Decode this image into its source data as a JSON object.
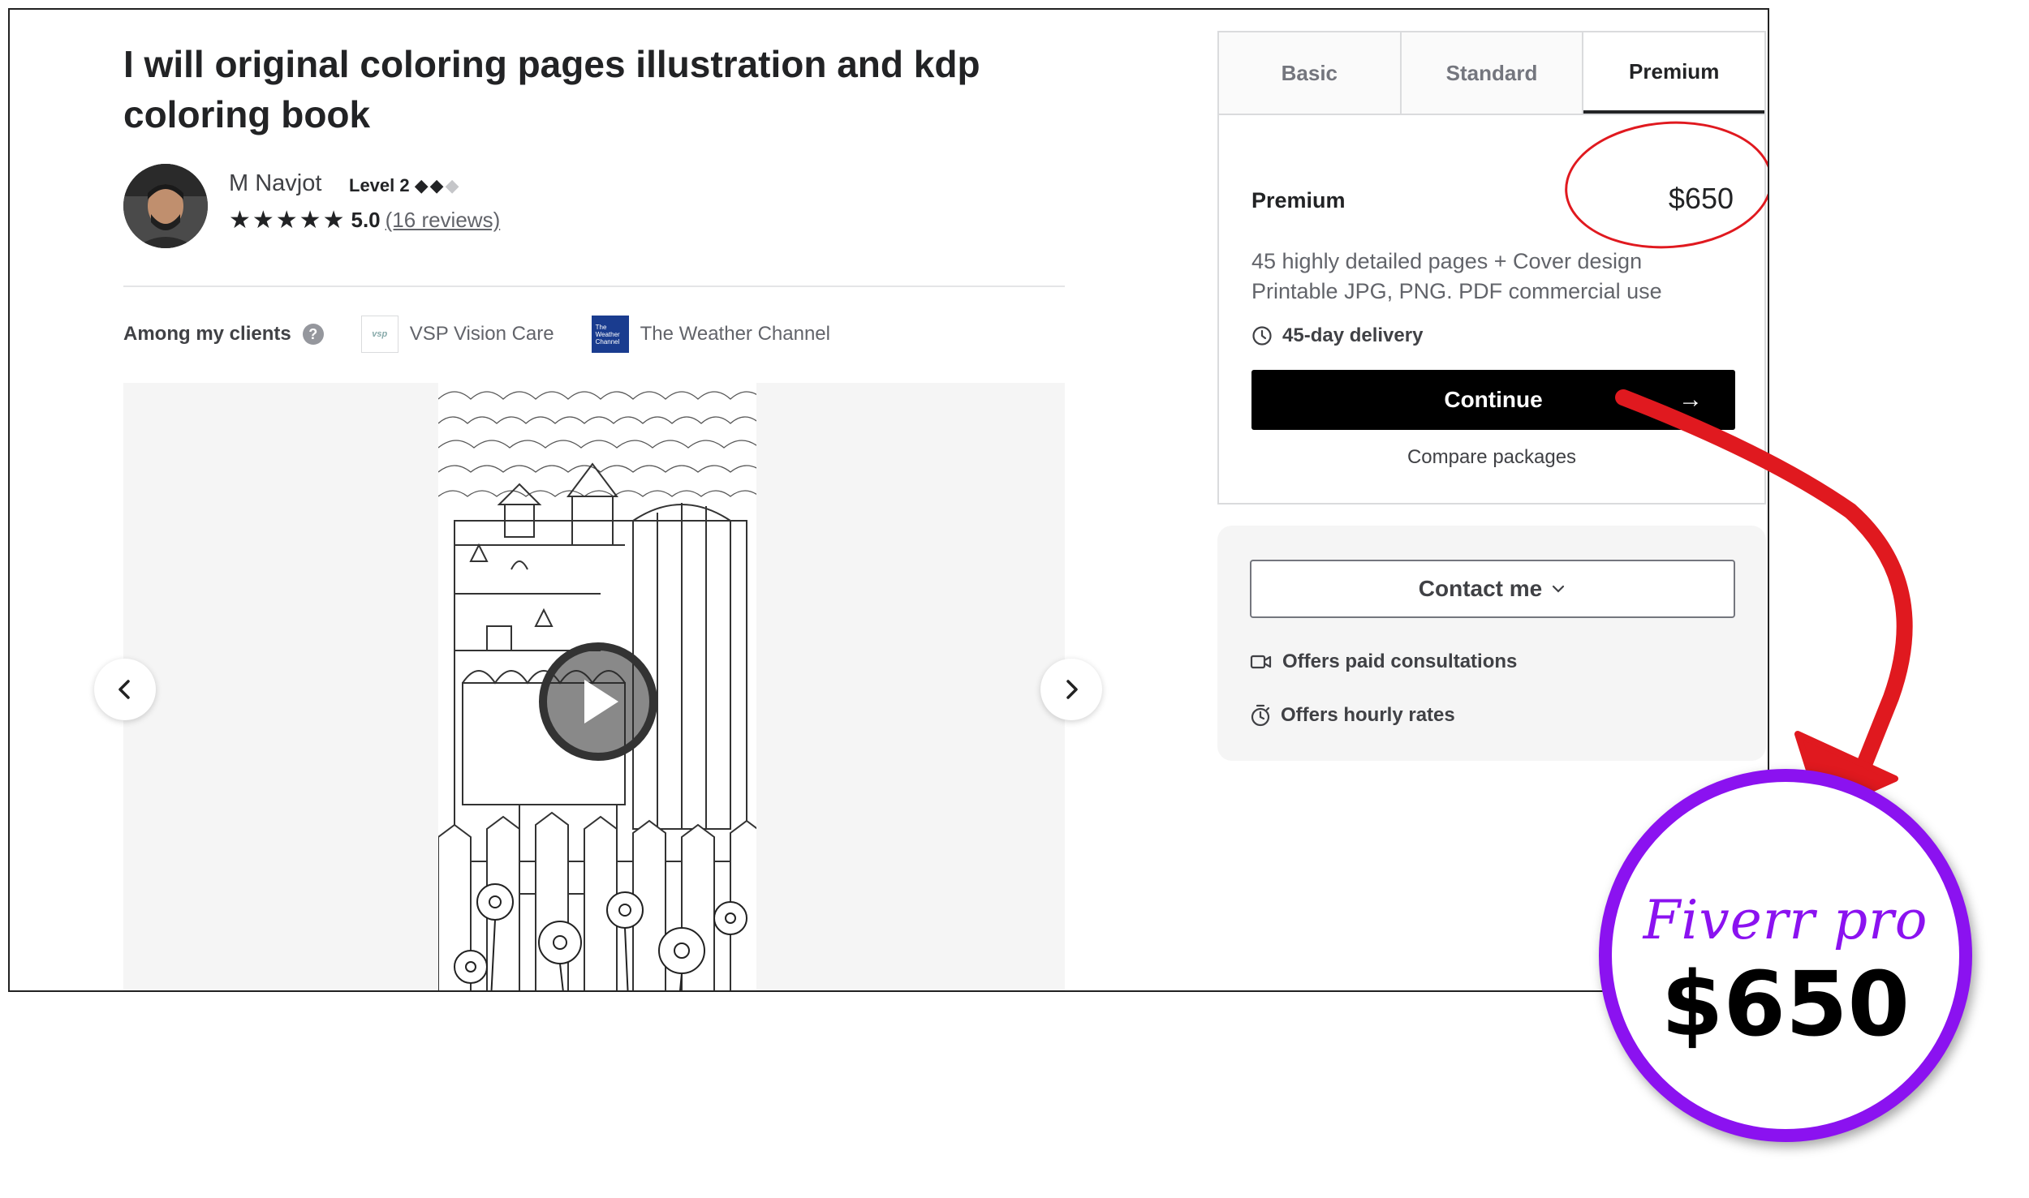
{
  "gig": {
    "title": "I will original coloring pages illustration and kdp coloring book"
  },
  "seller": {
    "name": "M Navjot",
    "level": "Level 2",
    "rating": "5.0",
    "reviews": "(16 reviews)"
  },
  "clients": {
    "label": "Among my clients",
    "items": [
      {
        "name": "VSP Vision Care",
        "logo_text": "vsp"
      },
      {
        "name": "The Weather Channel",
        "logo_text": "The Weather Channel"
      }
    ]
  },
  "gallery": {
    "media": "coloring-page-video",
    "icons": [
      "chevron-left-icon",
      "chevron-right-icon",
      "play-icon"
    ]
  },
  "packages": {
    "tabs": [
      "Basic",
      "Standard",
      "Premium"
    ],
    "active_tab": "Premium",
    "selected": {
      "name": "Premium",
      "price": "$650",
      "description_line1": "45 highly detailed pages + Cover design",
      "description_line2": "Printable JPG, PNG. PDF commercial use",
      "delivery": "45-day delivery"
    },
    "continue_label": "Continue",
    "continue_arrow": "→",
    "compare_label": "Compare packages"
  },
  "contact": {
    "button_label": "Contact me",
    "chevron": "⌄",
    "offers": [
      "Offers paid consultations",
      "Offers hourly rates"
    ]
  },
  "badge": {
    "brand": "Fiverr pro",
    "price": "$650"
  },
  "colors": {
    "annotation_red": "#e0191f",
    "badge_purple": "#8b12f0",
    "button_black": "#000000"
  }
}
